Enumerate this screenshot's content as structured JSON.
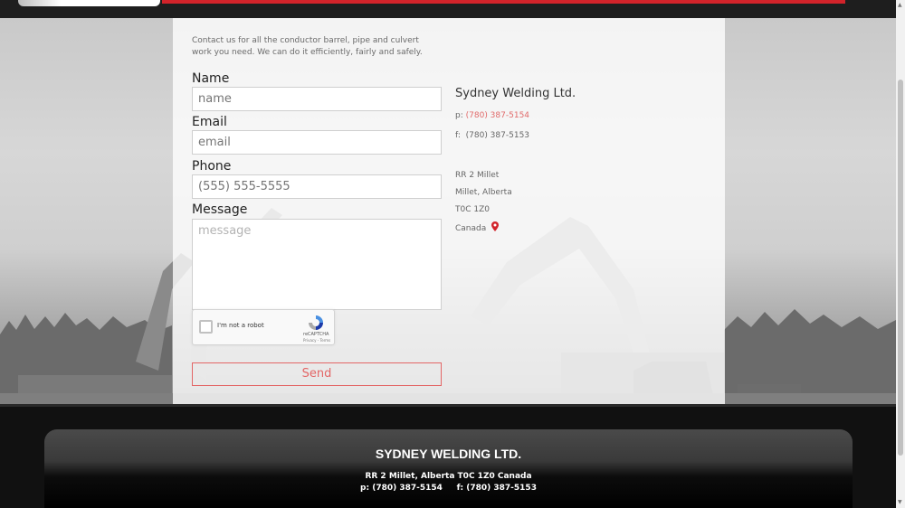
{
  "intro": "Contact us for all the conductor barrel, pipe and culvert work you need. We can do it efficiently, fairly and safely.",
  "form": {
    "name_label": "Name",
    "name_placeholder": "name",
    "email_label": "Email",
    "email_placeholder": "email",
    "phone_label": "Phone",
    "phone_placeholder": "(555) 555-5555",
    "message_label": "Message",
    "message_placeholder": "message",
    "send_label": "Send"
  },
  "captcha": {
    "label": "I'm not a robot",
    "brand": "reCAPTCHA",
    "terms": "Privacy - Terms"
  },
  "company": {
    "name": "Sydney Welding Ltd.",
    "phone_prefix": "p:",
    "phone": "(780) 387-5154",
    "fax_prefix": "f:",
    "fax": "(780) 387-5153",
    "address_line1": "RR 2 Millet",
    "address_line2": "Millet, Alberta",
    "postal": "T0C 1Z0",
    "country": "Canada"
  },
  "footer": {
    "title": "SYDNEY WELDING LTD.",
    "address": "RR 2 Millet, Alberta T0C 1Z0 Canada",
    "contact": "p: (780) 387-5154     f: (780) 387-5153"
  },
  "colors": {
    "accent_red": "#d2232a",
    "send_red": "#e36666",
    "link_red": "#e16a6a"
  }
}
